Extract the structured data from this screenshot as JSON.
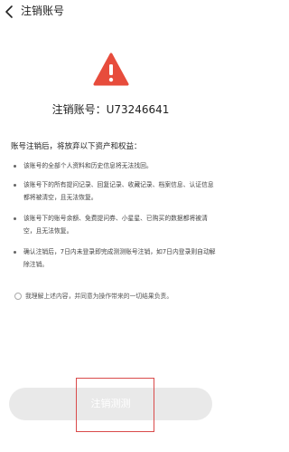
{
  "header": {
    "title": "注销账号",
    "back_icon": "back-arrow-icon"
  },
  "warning": {
    "icon": "warning-exclamation-icon",
    "color": "#e74c3c"
  },
  "account": {
    "line": "注销账号：U73246641"
  },
  "intro": "账号注销后，将放弃以下资产和权益：",
  "items": [
    "该账号的全部个人资料和历史信息将无法找回。",
    "该账号下的所有提问记录、回复记录、收藏记录、档案信息、认证信息都将被清空，且无法恢复。",
    "该账号下的账号余额、免费提问券、小星星、已购买的数据都将被清空，且无法恢复。",
    "确认注销后，7日内未登录即完成测测账号注销，如7日内登录则自动解除注销。"
  ],
  "agreement": {
    "text": "我理解上述内容，并同意为操作带来的一切结果负责。"
  },
  "submit": {
    "label": "注销测测"
  },
  "colors": {
    "accent": "#e74c3c",
    "button_bg": "#e9e9e9",
    "highlight_border": "#d94a4a"
  }
}
